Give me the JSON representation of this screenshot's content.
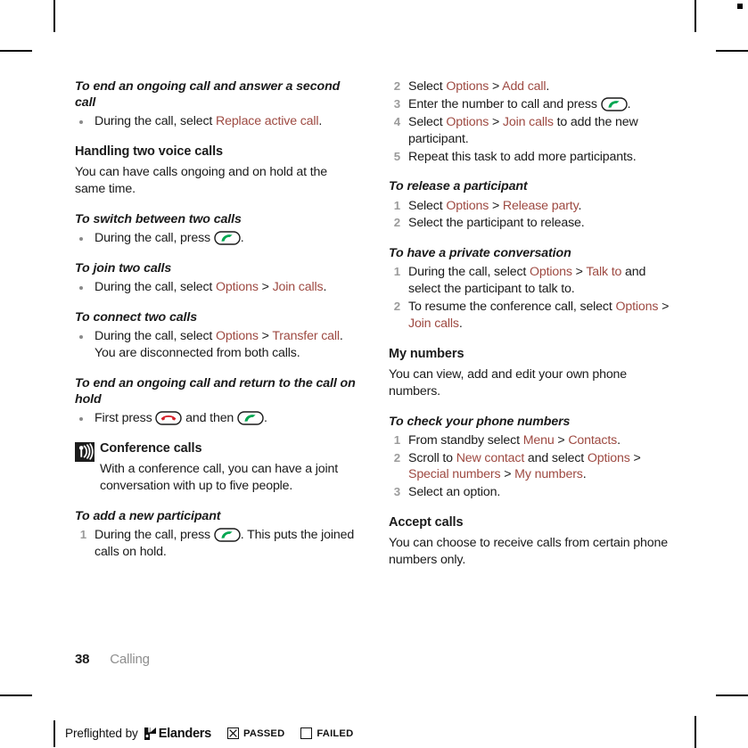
{
  "document": {
    "page_number": "38",
    "chapter": "Calling"
  },
  "icons": {
    "call_key": "green-call-handset-key-icon",
    "end_call_key": "red-end-call-handset-key-icon",
    "tip": "antenna-signal-icon"
  },
  "colors": {
    "ui_reference_text": "#9e4a42",
    "call_key_green": "#00a650",
    "end_key_red": "#d5202a",
    "body_text": "#1a1a1a",
    "muted_text": "#8e8e8e"
  },
  "left_column": {
    "sections": [
      {
        "id": "end-and-answer",
        "heading": "To end an ongoing call and answer a second call",
        "bullets": [
          {
            "segments": [
              {
                "text": "During the call, select ",
                "style": "plain"
              },
              {
                "text": "Replace active call",
                "style": "ui"
              },
              {
                "text": ".",
                "style": "plain"
              }
            ]
          }
        ]
      },
      {
        "id": "handling-two-voice-calls",
        "heading": "Handling two voice calls",
        "body": "You can have calls ongoing and on hold at the same time."
      },
      {
        "id": "switch-between-two-calls",
        "heading": "To switch between two calls",
        "bullets": [
          {
            "segments": [
              {
                "text": "During the call, press ",
                "style": "plain"
              },
              {
                "text": "",
                "style": "key-call"
              },
              {
                "text": ".",
                "style": "plain"
              }
            ]
          }
        ]
      },
      {
        "id": "join-two-calls",
        "heading": "To join two calls",
        "bullets": [
          {
            "segments": [
              {
                "text": "During the call, select ",
                "style": "plain"
              },
              {
                "text": "Options",
                "style": "ui"
              },
              {
                "text": " > ",
                "style": "plain"
              },
              {
                "text": "Join calls",
                "style": "ui"
              },
              {
                "text": ".",
                "style": "plain"
              }
            ]
          }
        ]
      },
      {
        "id": "connect-two-calls",
        "heading": "To connect two calls",
        "bullets": [
          {
            "segments": [
              {
                "text": "During the call, select ",
                "style": "plain"
              },
              {
                "text": "Options",
                "style": "ui"
              },
              {
                "text": " > ",
                "style": "plain"
              },
              {
                "text": "Transfer call",
                "style": "ui"
              },
              {
                "text": ". You are disconnected from both calls.",
                "style": "plain"
              }
            ]
          }
        ]
      },
      {
        "id": "end-and-return-to-hold",
        "heading": "To end an ongoing call and return to the call on hold",
        "bullets": [
          {
            "segments": [
              {
                "text": "First press ",
                "style": "plain"
              },
              {
                "text": "",
                "style": "key-end"
              },
              {
                "text": " and then ",
                "style": "plain"
              },
              {
                "text": "",
                "style": "key-call"
              },
              {
                "text": ".",
                "style": "plain"
              }
            ]
          }
        ]
      },
      {
        "id": "conference-calls",
        "heading": "Conference calls",
        "body": "With a conference call, you can have a joint conversation with up to five people.",
        "has_tip_icon": true
      },
      {
        "id": "add-new-participant",
        "heading": "To add a new participant",
        "steps": [
          {
            "segments": [
              {
                "text": "During the call, press ",
                "style": "plain"
              },
              {
                "text": "",
                "style": "key-call"
              },
              {
                "text": ". This puts the joined calls on hold.",
                "style": "plain"
              }
            ]
          }
        ]
      }
    ]
  },
  "right_column": {
    "sections": [
      {
        "id": "add-new-participant-continued",
        "heading": "",
        "start_number": 2,
        "steps": [
          {
            "segments": [
              {
                "text": "Select ",
                "style": "plain"
              },
              {
                "text": "Options",
                "style": "ui"
              },
              {
                "text": " > ",
                "style": "plain"
              },
              {
                "text": "Add call",
                "style": "ui"
              },
              {
                "text": ".",
                "style": "plain"
              }
            ]
          },
          {
            "segments": [
              {
                "text": "Enter the number to call and press ",
                "style": "plain"
              },
              {
                "text": "",
                "style": "key-call"
              },
              {
                "text": ".",
                "style": "plain"
              }
            ]
          },
          {
            "segments": [
              {
                "text": "Select ",
                "style": "plain"
              },
              {
                "text": "Options",
                "style": "ui"
              },
              {
                "text": " > ",
                "style": "plain"
              },
              {
                "text": "Join calls",
                "style": "ui"
              },
              {
                "text": " to add the new participant.",
                "style": "plain"
              }
            ]
          },
          {
            "segments": [
              {
                "text": "Repeat this task to add more participants.",
                "style": "plain"
              }
            ]
          }
        ]
      },
      {
        "id": "release-a-participant",
        "heading": "To release a participant",
        "steps": [
          {
            "segments": [
              {
                "text": "Select ",
                "style": "plain"
              },
              {
                "text": "Options",
                "style": "ui"
              },
              {
                "text": " > ",
                "style": "plain"
              },
              {
                "text": "Release party",
                "style": "ui"
              },
              {
                "text": ".",
                "style": "plain"
              }
            ]
          },
          {
            "segments": [
              {
                "text": "Select the participant to release.",
                "style": "plain"
              }
            ]
          }
        ]
      },
      {
        "id": "private-conversation",
        "heading": "To have a private conversation",
        "steps": [
          {
            "segments": [
              {
                "text": "During the call, select ",
                "style": "plain"
              },
              {
                "text": "Options",
                "style": "ui"
              },
              {
                "text": " > ",
                "style": "plain"
              },
              {
                "text": "Talk to",
                "style": "ui"
              },
              {
                "text": " and select the participant to talk to.",
                "style": "plain"
              }
            ]
          },
          {
            "segments": [
              {
                "text": "To resume the conference call, select ",
                "style": "plain"
              },
              {
                "text": "Options",
                "style": "ui"
              },
              {
                "text": " > ",
                "style": "plain"
              },
              {
                "text": "Join calls",
                "style": "ui"
              },
              {
                "text": ".",
                "style": "plain"
              }
            ]
          }
        ]
      },
      {
        "id": "my-numbers",
        "heading": "My numbers",
        "body": "You can view, add and edit your own phone numbers."
      },
      {
        "id": "check-phone-numbers",
        "heading": "To check your phone numbers",
        "steps": [
          {
            "segments": [
              {
                "text": "From standby select ",
                "style": "plain"
              },
              {
                "text": "Menu",
                "style": "ui"
              },
              {
                "text": " > ",
                "style": "plain"
              },
              {
                "text": "Contacts",
                "style": "ui"
              },
              {
                "text": ".",
                "style": "plain"
              }
            ]
          },
          {
            "segments": [
              {
                "text": "Scroll to ",
                "style": "plain"
              },
              {
                "text": "New contact",
                "style": "ui"
              },
              {
                "text": " and select ",
                "style": "plain"
              },
              {
                "text": "Options",
                "style": "ui"
              },
              {
                "text": " > ",
                "style": "plain"
              },
              {
                "text": "Special numbers",
                "style": "ui"
              },
              {
                "text": " > ",
                "style": "plain"
              },
              {
                "text": "My numbers",
                "style": "ui"
              },
              {
                "text": ".",
                "style": "plain"
              }
            ]
          },
          {
            "segments": [
              {
                "text": "Select an option.",
                "style": "plain"
              }
            ]
          }
        ]
      },
      {
        "id": "accept-calls",
        "heading": "Accept calls",
        "body": "You can choose to receive calls from certain phone numbers only."
      }
    ]
  },
  "preflight": {
    "prefix": "Preflighted by",
    "brand": "Elanders",
    "passed_label": "PASSED",
    "failed_label": "FAILED",
    "passed_checked": true,
    "failed_checked": false
  }
}
